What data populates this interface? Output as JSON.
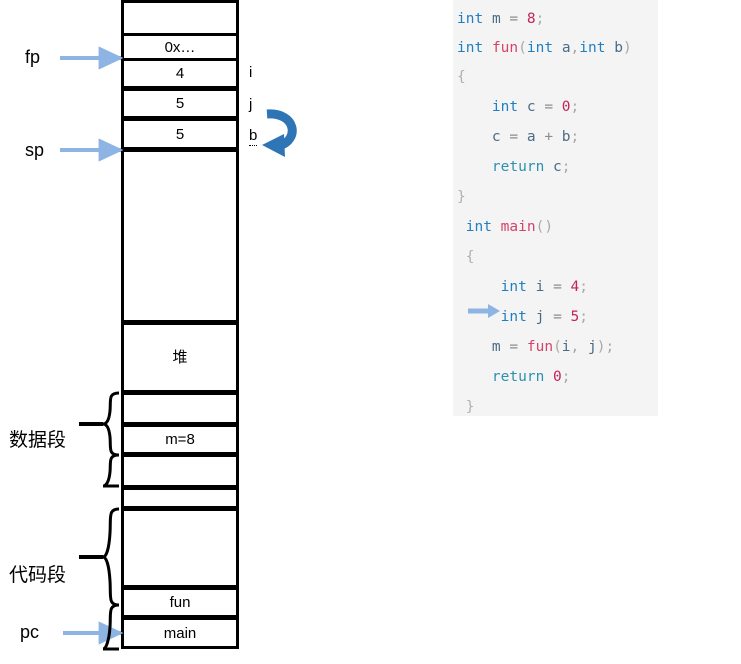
{
  "diagram": {
    "title": "C program memory layout with stack, heap, data segment and code segment",
    "colors": {
      "pointer_arrow": "#8eb4e3",
      "curved_arrow": "#2e75b6",
      "box_border": "#000000",
      "code_panel_bg": "#f4f4f4",
      "keyword": "#1f7fbf",
      "function": "#d4436b",
      "number": "#c0245a",
      "operator": "#8d8d8d"
    },
    "stack_cells": [
      {
        "name": "stack-top-empty",
        "text": "",
        "side_label": ""
      },
      {
        "name": "saved-frame-pointer",
        "text": "0x…",
        "side_label": ""
      },
      {
        "name": "local-i",
        "text": "4",
        "side_label": "i"
      },
      {
        "name": "local-j",
        "text": "5",
        "side_label": "j"
      },
      {
        "name": "param-b",
        "text": "5",
        "side_label": "b"
      },
      {
        "name": "stack-free-space",
        "text": "",
        "side_label": ""
      }
    ],
    "heap_cell": {
      "name": "heap",
      "text": "堆"
    },
    "data_cells": [
      {
        "name": "data-empty-upper",
        "text": ""
      },
      {
        "name": "global-m",
        "text": "m=8"
      },
      {
        "name": "data-empty-lower",
        "text": ""
      }
    ],
    "gap_cell": {
      "name": "segment-gap",
      "text": ""
    },
    "code_cells": [
      {
        "name": "code-empty",
        "text": ""
      },
      {
        "name": "code-fun",
        "text": "fun"
      },
      {
        "name": "code-main",
        "text": "main"
      }
    ],
    "pointers": [
      {
        "name": "fp",
        "label": "fp"
      },
      {
        "name": "sp",
        "label": "sp"
      },
      {
        "name": "pc",
        "label": "pc"
      }
    ],
    "segments": [
      {
        "name": "data-segment",
        "label": "数据段"
      },
      {
        "name": "code-segment",
        "label": "代码段"
      }
    ]
  },
  "code": {
    "language": "C",
    "current_line_index": 9,
    "lines": [
      {
        "index": 0,
        "text": "int m = 8;"
      },
      {
        "index": 1,
        "text": "int fun(int a,int b)"
      },
      {
        "index": 2,
        "text": "{"
      },
      {
        "index": 3,
        "text": "    int c = 0;"
      },
      {
        "index": 4,
        "text": "    c = a + b;"
      },
      {
        "index": 5,
        "text": "    return c;"
      },
      {
        "index": 6,
        "text": "}"
      },
      {
        "index": 7,
        "text": " int main()"
      },
      {
        "index": 8,
        "text": " {"
      },
      {
        "index": 9,
        "text": "     int i = 4;"
      },
      {
        "index": 10,
        "text": "     int j = 5;"
      },
      {
        "index": 11,
        "text": "     m = fun(i, j);"
      },
      {
        "index": 12,
        "text": "     return 0;"
      },
      {
        "index": 13,
        "text": " }"
      }
    ]
  }
}
